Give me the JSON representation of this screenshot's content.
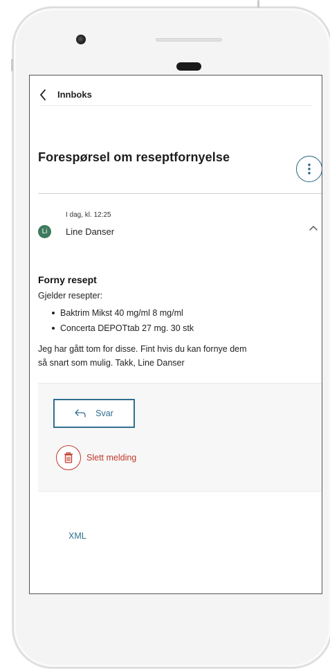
{
  "header": {
    "back_label": "Innboks"
  },
  "title": "Forespørsel om reseptfornyelse",
  "message": {
    "date": "I dag, kl. 12:25",
    "sender_initials": "Li",
    "sender_name": "Line Danser",
    "heading": "Forny resept",
    "subheading": "Gjelder resepter:",
    "prescriptions": [
      "Baktrim Mikst 40 mg/ml 8 mg/ml",
      "Concerta DEPOTtab 27 mg. 30 stk"
    ],
    "body_line1": "Jeg har gått tom for disse. Fint hvis du kan fornye dem",
    "body_line2": "så snart som mulig. Takk, Line Danser"
  },
  "actions": {
    "reply_label": "Svar",
    "delete_label": "Slett melding"
  },
  "footer": {
    "xml_link": "XML"
  },
  "colors": {
    "accent": "#2e6f8e",
    "danger": "#c0392b",
    "avatar": "#3d7a5c"
  },
  "icons": [
    "back-chevron-icon",
    "more-vertical-icon",
    "chevron-up-icon",
    "reply-arrow-icon",
    "trash-icon"
  ]
}
